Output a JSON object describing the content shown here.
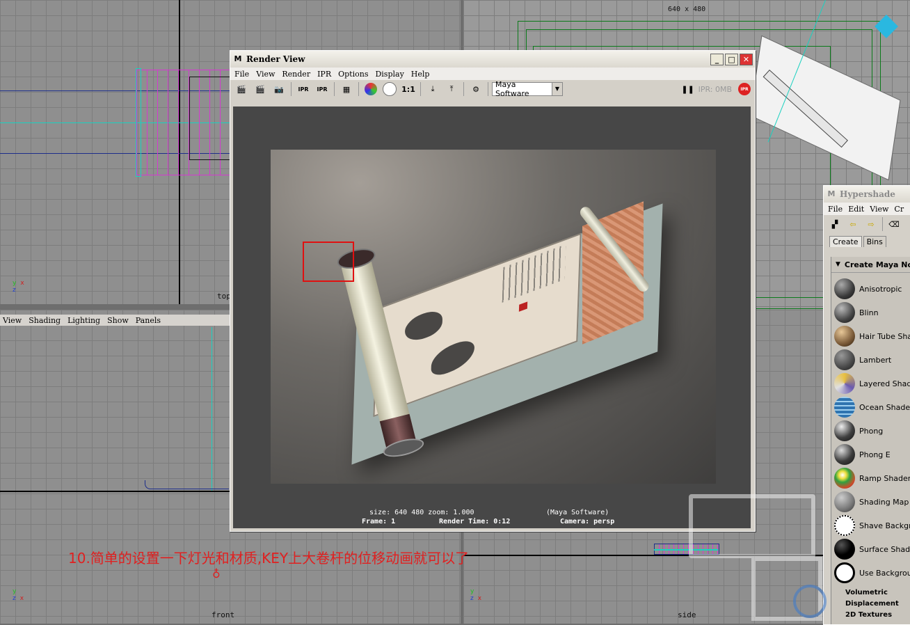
{
  "viewports": {
    "top_label": "top",
    "front_label": "front",
    "side_label": "side",
    "persp_resolution": "640 x 480",
    "panel_menu": [
      "View",
      "Shading",
      "Lighting",
      "Show",
      "Panels"
    ]
  },
  "render_view": {
    "title": "Render View",
    "menu": [
      "File",
      "View",
      "Render",
      "IPR",
      "Options",
      "Display",
      "Help"
    ],
    "toolbar": {
      "ratio": "1:1",
      "renderer": "Maya Software",
      "ipr_status": "IPR: 0MB",
      "ipr_badge": "IPR",
      "ipr_icon_text": "IPR"
    },
    "status": {
      "line1_left": "size:  640  480 zoom: 1.000",
      "line1_right": "(Maya Software)",
      "line2_a": "Frame: 1",
      "line2_b": "Render Time: 0:12",
      "line2_c": "Camera: persp"
    }
  },
  "hypershade": {
    "title": "Hypershade",
    "menu": [
      "File",
      "Edit",
      "View",
      "Cr"
    ],
    "tabs": [
      "Create",
      "Bins"
    ],
    "section": "Create Maya No",
    "items": [
      {
        "label": "Anisotropic",
        "color": "#3a3a3a"
      },
      {
        "label": "Blinn",
        "color": "#444444"
      },
      {
        "label": "Hair Tube Sha",
        "color": "#7a5a38"
      },
      {
        "label": "Lambert",
        "color": "#484848"
      },
      {
        "label": "Layered Shade",
        "color": "#8a7fb0"
      },
      {
        "label": "Ocean Shader",
        "color": "#2f74b0"
      },
      {
        "label": "Phong",
        "color": "#404040"
      },
      {
        "label": "Phong E",
        "color": "#3c3c3c"
      },
      {
        "label": "Ramp Shader",
        "color": "#d04a2a"
      },
      {
        "label": "Shading Map",
        "color": "#777777"
      },
      {
        "label": "Shave Backgr",
        "color": "#ffffff"
      },
      {
        "label": "Surface Shade",
        "color": "#000000"
      },
      {
        "label": "Use Backgrou",
        "color": "#ffffff"
      }
    ],
    "sub_sections": [
      "Volumetric",
      "Displacement",
      "2D Textures"
    ]
  },
  "caption": "10.简单的设置一下灯光和材质,KEY上大卷杆的位移动画就可以了",
  "accent_colors": {
    "caption": "#e02020",
    "selection_box": "#e01010",
    "curve": "#19d1c0"
  }
}
